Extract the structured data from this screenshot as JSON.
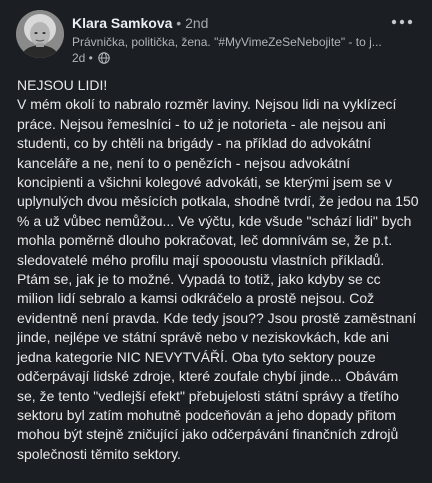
{
  "post": {
    "author": {
      "name": "Klara Samkova",
      "degree": " • 2nd",
      "headline": "Právnička, politička, žena. \"#MyVimeZeSeNebojite\" - to j...",
      "time": "2d •"
    },
    "body": {
      "title": "NEJSOU LIDI!",
      "text": "V mém okolí to nabralo rozměr laviny. Nejsou lidi na vyklízecí práce. Nejsou řemeslníci - to už je notorieta - ale nejsou ani studenti, co by chtěli na brigády - na příklad do advokátní kanceláře a ne, není to o penězích - nejsou advokátní koncipienti a všichni kolegové advokáti, se kterými jsem se v uplynulých dvou měsících potkala, shodně tvrdí, že jedou na 150 % a už vůbec nemůžou... Ve výčtu, kde všude \"schází lidi\" bych mohla poměrně dlouho pokračovat, leč domnívám se, že p.t. sledovatelé mého profilu mají spoooustu vlastních příkladů. Ptám se, jak je to možné. Vypadá to totiž, jako kdyby se cc milion lidí sebralo a kamsi odkráčelo a prostě nejsou. Což evidentně není pravda. Kde tedy jsou?? Jsou prostě zaměstnaní jinde, nejlépe ve státní správě nebo v neziskovkách, kde ani jedna kategorie NIC NEVYTVÁŘÍ. Oba tyto sektory pouze odčerpávají lidské zdroje, které zoufale chybí jinde... Obávám se, že tento \"vedlejší efekt\" přebujelosti státní správy a třetího sektoru byl zatím mohutně podceňován a jeho dopady přitom mohou být stejně zničující jako odčerpávání finančních zdrojů společnosti těmito sektory."
    }
  },
  "icons": {
    "more": "more-horizontal-icon",
    "visibility": "globe-icon"
  },
  "colors": {
    "background": "#1b1f23",
    "text": "#e8e9ea",
    "muted": "#b0b3b8"
  }
}
